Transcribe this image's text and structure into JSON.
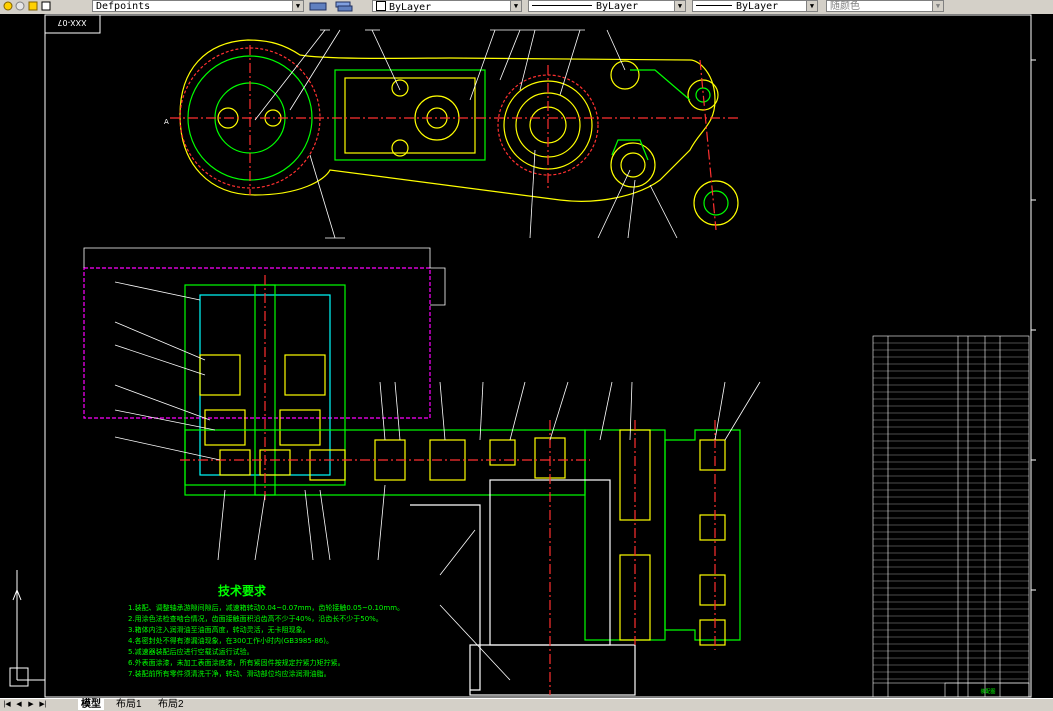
{
  "toolbar": {
    "layer_name": "Defpoints",
    "color_value": "ByLayer",
    "linetype_value": "ByLayer",
    "lineweight_value": "ByLayer",
    "plotstyle_value": "随颜色"
  },
  "drawing": {
    "drawing_code": "XXX-07",
    "section_label": "A",
    "notes_title": "技术要求",
    "notes": [
      "1.装配、调整轴承游隙间隙后，减速箱转动0.04~0.07mm，齿轮接触0.05~0.10mm。",
      "2.用涂色法检查啮合情况，齿面接触面积沿齿高不少于40%，沿齿长不少于50%。",
      "3.箱体内注入润滑油至油面高度，转动灵活，无卡阻现象。",
      "4.各密封处不得有渗漏油现象，在300工作小时内(GB3985-86)。",
      "5.减速器装配后应进行空载试运行试验。",
      "6.外表面涂漆，未加工表面涂底漆，所有紧固件按规定拧紧力矩拧紧。",
      "7.装配前所有零件须清洗干净，转动、滑动部位均应涂润滑油脂。"
    ],
    "title_block": "装配图"
  },
  "tabs": [
    "模型",
    "布局1",
    "布局2"
  ],
  "colors": {
    "toolbar_bg": "#d4d0c8",
    "canvas_bg": "#000000",
    "cad_yellow": "#ffff00",
    "cad_green": "#00ff00",
    "cad_red": "#ff3030",
    "cad_magenta": "#ff00ff",
    "cad_cyan": "#00ffff",
    "cad_white": "#ffffff"
  }
}
